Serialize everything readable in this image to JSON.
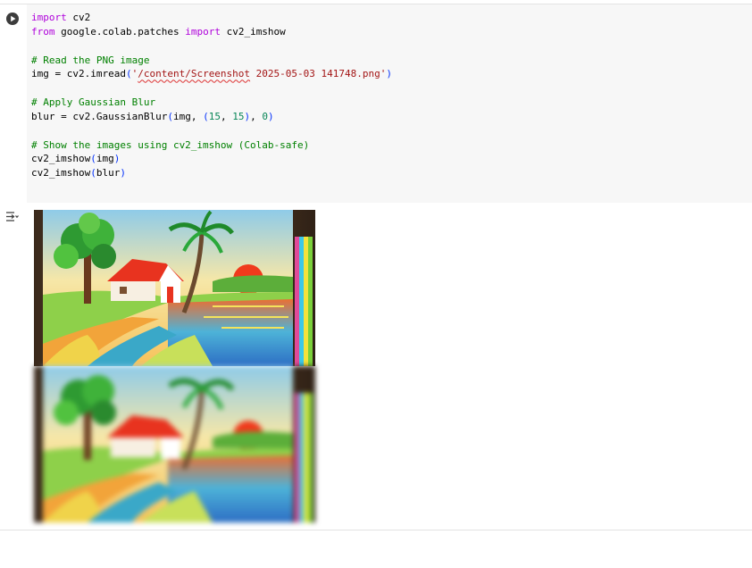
{
  "cell": {
    "lines": [
      [
        {
          "t": "import",
          "c": "kw"
        },
        {
          "t": " cv2"
        }
      ],
      [
        {
          "t": "from",
          "c": "kw"
        },
        {
          "t": " google.colab.patches "
        },
        {
          "t": "import",
          "c": "kw"
        },
        {
          "t": " cv2_imshow"
        }
      ],
      [],
      [
        {
          "t": "# Read the PNG image",
          "c": "cm"
        }
      ],
      [
        {
          "t": "img = cv2.imread"
        },
        {
          "t": "(",
          "c": "pn"
        },
        {
          "t": "'",
          "c": "st"
        },
        {
          "t": "/content/Screenshot",
          "c": "st sq"
        },
        {
          "t": " 2025-05-03 141748.png'",
          "c": "st"
        },
        {
          "t": ")",
          "c": "pn"
        }
      ],
      [],
      [
        {
          "t": "# Apply Gaussian Blur",
          "c": "cm"
        }
      ],
      [
        {
          "t": "blur = cv2.GaussianBlur"
        },
        {
          "t": "(",
          "c": "pn"
        },
        {
          "t": "img, "
        },
        {
          "t": "(",
          "c": "pn"
        },
        {
          "t": "15",
          "c": "nm"
        },
        {
          "t": ", "
        },
        {
          "t": "15",
          "c": "nm"
        },
        {
          "t": ")",
          "c": "pn"
        },
        {
          "t": ", "
        },
        {
          "t": "0",
          "c": "nm"
        },
        {
          "t": ")",
          "c": "pn"
        }
      ],
      [],
      [
        {
          "t": "# Show the images using cv2_imshow (Colab-safe)",
          "c": "cm"
        }
      ],
      [
        {
          "t": "cv2_imshow"
        },
        {
          "t": "(",
          "c": "pn"
        },
        {
          "t": "img"
        },
        {
          "t": ")",
          "c": "pn"
        }
      ],
      [
        {
          "t": "cv2_imshow"
        },
        {
          "t": "(",
          "c": "pn"
        },
        {
          "t": "blur"
        },
        {
          "t": ")",
          "c": "pn"
        }
      ]
    ]
  },
  "icons": {
    "run": "play-circle-icon",
    "output": "output-actions-icon"
  },
  "output": {
    "images": [
      {
        "alt": "village landscape drawing (original)"
      },
      {
        "alt": "village landscape drawing (gaussian blurred)"
      }
    ]
  },
  "colors": {
    "editor_bg": "#f7f7f7",
    "keyword": "#af00db",
    "comment": "#008000",
    "number": "#098658",
    "string": "#a31515"
  }
}
